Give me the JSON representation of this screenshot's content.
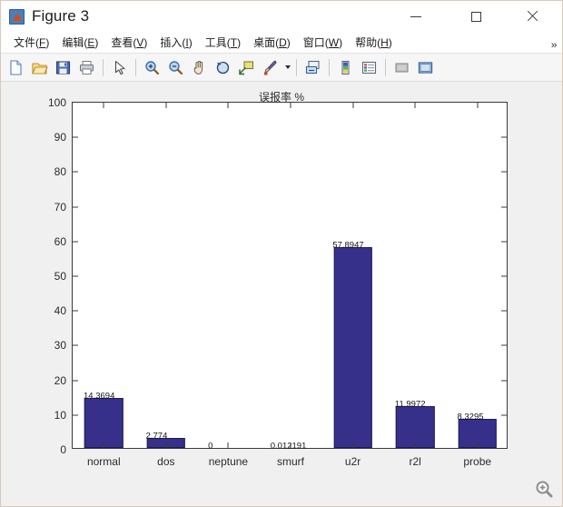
{
  "window": {
    "title": "Figure 3",
    "app_icon": "matlab-figure-icon",
    "controls": {
      "minimize": "minimize-icon",
      "maximize": "maximize-icon",
      "close": "close-icon"
    }
  },
  "menubar": {
    "items": [
      {
        "label": "文件(F)",
        "text": "文件(",
        "mnemonic": "F",
        "tail": ")"
      },
      {
        "label": "编辑(E)",
        "text": "编辑(",
        "mnemonic": "E",
        "tail": ")"
      },
      {
        "label": "查看(V)",
        "text": "查看(",
        "mnemonic": "V",
        "tail": ")"
      },
      {
        "label": "插入(I)",
        "text": "插入(",
        "mnemonic": "I",
        "tail": ")"
      },
      {
        "label": "工具(T)",
        "text": "工具(",
        "mnemonic": "T",
        "tail": ")"
      },
      {
        "label": "桌面(D)",
        "text": "桌面(",
        "mnemonic": "D",
        "tail": ")"
      },
      {
        "label": "窗口(W)",
        "text": "窗口(",
        "mnemonic": "W",
        "tail": ")"
      },
      {
        "label": "帮助(H)",
        "text": "帮助(",
        "mnemonic": "H",
        "tail": ")"
      }
    ],
    "overflow_glyph": "»"
  },
  "toolbar": {
    "buttons": [
      "new-figure-icon",
      "open-file-icon",
      "save-figure-icon",
      "print-figure-icon",
      "pointer-icon",
      "zoom-in-icon",
      "zoom-out-icon",
      "pan-icon",
      "rotate-3d-icon",
      "data-cursor-icon",
      "brush-icon",
      "brush-dropdown-icon",
      "link-plot-icon",
      "colorbar-icon",
      "legend-icon",
      "hide-plot-tools-icon",
      "show-plot-tools-icon"
    ]
  },
  "status": {
    "zoom_badge_icon": "magnifier-plus-icon"
  },
  "chart_data": {
    "type": "bar",
    "title": "误报率 %",
    "xlabel": "",
    "ylabel": "",
    "categories": [
      "normal",
      "dos",
      "neptune",
      "smurf",
      "u2r",
      "r2l",
      "probe"
    ],
    "values": [
      14.3694,
      2.774,
      0,
      0.012191,
      57.8947,
      11.9972,
      8.3295
    ],
    "point_labels": [
      "14.3694",
      "2.774",
      "0",
      "0.012191",
      "57.8947",
      "11.9972",
      "8.3295"
    ],
    "ylim": [
      0,
      100
    ],
    "yticks": [
      0,
      10,
      20,
      30,
      40,
      50,
      60,
      70,
      80,
      90,
      100
    ],
    "ytick_labels": [
      "0",
      "10",
      "20",
      "30",
      "40",
      "50",
      "60",
      "70",
      "80",
      "90",
      "100"
    ],
    "xlim": [
      0.5,
      7.5
    ],
    "grid": false,
    "legend": false,
    "bar_color": "#36308a",
    "bar_edge_color": "#1e1a54",
    "axes_background": "#ffffff",
    "figure_background": "#f0f0f0"
  }
}
